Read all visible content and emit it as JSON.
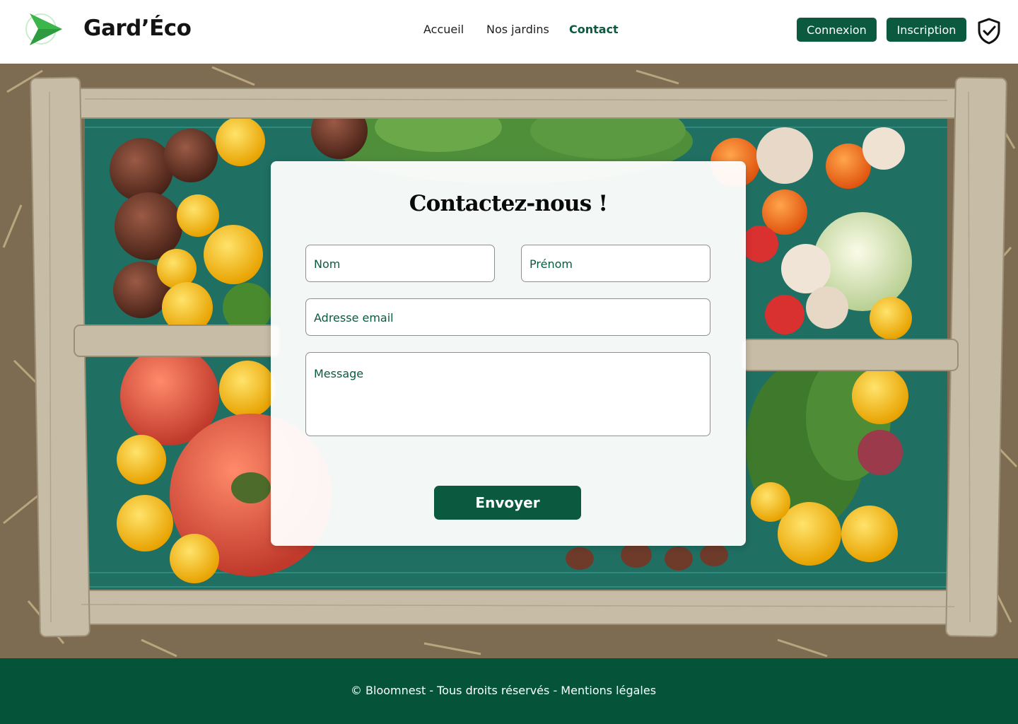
{
  "header": {
    "brand": "Gard’Éco",
    "nav": [
      {
        "label": "Accueil",
        "active": false
      },
      {
        "label": "Nos jardins",
        "active": false
      },
      {
        "label": "Contact",
        "active": true
      }
    ],
    "login_label": "Connexion",
    "signup_label": "Inscription",
    "logo_icon": "paper-plane-logo-icon",
    "shield_icon": "shield-check-icon"
  },
  "hero": {
    "background": "vegetable-crate-photo"
  },
  "form": {
    "title": "Contactez-nous !",
    "nom_placeholder": "Nom",
    "prenom_placeholder": "Prénom",
    "email_placeholder": "Adresse email",
    "message_placeholder": "Message",
    "submit_label": "Envoyer"
  },
  "footer": {
    "text": "© Bloomnest - Tous droits réservés - Mentions légales"
  },
  "colors": {
    "brand_green": "#0b5a3f",
    "footer_green": "#05543a",
    "logo_green": "#3cb54a"
  }
}
